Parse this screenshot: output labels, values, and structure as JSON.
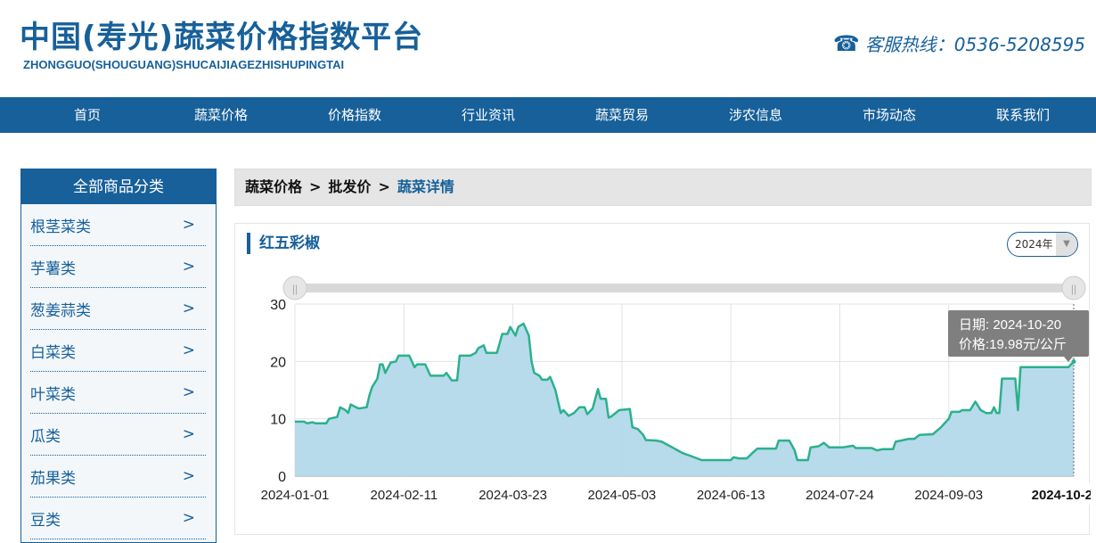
{
  "header": {
    "title": "中国(寿光)蔬菜价格指数平台",
    "subtitle": "ZHONGGUO(SHOUGUANG)SHUCAIJIAGEZHISHUPINGTAI",
    "hotline": "客服热线：0536-5208595"
  },
  "nav": [
    "首页",
    "蔬菜价格",
    "价格指数",
    "行业资讯",
    "蔬菜贸易",
    "涉农信息",
    "市场动态",
    "联系我们"
  ],
  "sidebar": {
    "title": "全部商品分类",
    "items": [
      "根茎菜类",
      "芋薯类",
      "葱姜蒜类",
      "白菜类",
      "叶菜类",
      "瓜类",
      "茄果类",
      "豆类"
    ],
    "arrow": ">"
  },
  "breadcrumb": {
    "items": [
      "蔬菜价格",
      "批发价"
    ],
    "current": "蔬菜详情",
    "sep": ">"
  },
  "panel": {
    "title": "红五彩椒",
    "year": "2024年"
  },
  "tooltip": {
    "date": "日期: 2024-10-20",
    "price": "价格:19.98元/公斤"
  },
  "chart_data": {
    "type": "area",
    "x_start": "2024-01-01",
    "x_unit": "days since 2024-01-01",
    "ylim": [
      0,
      30
    ],
    "yticks": [
      0,
      10,
      20,
      30
    ],
    "xticks": [
      {
        "day": 0,
        "label": "2024-01-01"
      },
      {
        "day": 41,
        "label": "2024-02-11"
      },
      {
        "day": 82,
        "label": "2024-03-23"
      },
      {
        "day": 123,
        "label": "2024-05-03"
      },
      {
        "day": 164,
        "label": "2024-06-13"
      },
      {
        "day": 205,
        "label": "2024-07-24"
      },
      {
        "day": 246,
        "label": "2024-09-03"
      }
    ],
    "highlight": {
      "day": 293,
      "label": "2024-10-20",
      "value": 19.98
    },
    "series": {
      "name": "价格",
      "color": "#2bb08d",
      "fill": "#b3d9ea",
      "points": [
        [
          0,
          9.5
        ],
        [
          3.5,
          9.5
        ],
        [
          4.6,
          9.2
        ],
        [
          6.6,
          9.4
        ],
        [
          7.7,
          9.2
        ],
        [
          11.8,
          9.2
        ],
        [
          12.8,
          10
        ],
        [
          15.9,
          10.3
        ],
        [
          17,
          12
        ],
        [
          19,
          11.5
        ],
        [
          20,
          11
        ],
        [
          21,
          12.5
        ],
        [
          23,
          12
        ],
        [
          24,
          11.8
        ],
        [
          27,
          12
        ],
        [
          28,
          14
        ],
        [
          29,
          15.5
        ],
        [
          31,
          17
        ],
        [
          32,
          19.5
        ],
        [
          33,
          19.5
        ],
        [
          34,
          18
        ],
        [
          36,
          19.8
        ],
        [
          38,
          20
        ],
        [
          39,
          21
        ],
        [
          43,
          21
        ],
        [
          45,
          19
        ],
        [
          46,
          19.5
        ],
        [
          49,
          19.5
        ],
        [
          51,
          17.5
        ],
        [
          56,
          17.5
        ],
        [
          57,
          18
        ],
        [
          59,
          16.7
        ],
        [
          61,
          16.7
        ],
        [
          62,
          21
        ],
        [
          66,
          21
        ],
        [
          68,
          21.5
        ],
        [
          69,
          22.3
        ],
        [
          71,
          22.8
        ],
        [
          72,
          21.5
        ],
        [
          76,
          21.5
        ],
        [
          78,
          24.8
        ],
        [
          80,
          24.8
        ],
        [
          81,
          26
        ],
        [
          83,
          24.5
        ],
        [
          84,
          26
        ],
        [
          86,
          26.6
        ],
        [
          88,
          24.5
        ],
        [
          89,
          20
        ],
        [
          90,
          18
        ],
        [
          92,
          17.5
        ],
        [
          93,
          16.8
        ],
        [
          95,
          16.8
        ],
        [
          96,
          17.3
        ],
        [
          98,
          15
        ],
        [
          100,
          11
        ],
        [
          101,
          11.5
        ],
        [
          103,
          10.5
        ],
        [
          105,
          11
        ],
        [
          107,
          12
        ],
        [
          109,
          12
        ],
        [
          110,
          10.8
        ],
        [
          112,
          11.8
        ],
        [
          114,
          15.2
        ],
        [
          115,
          13.5
        ],
        [
          117,
          13.5
        ],
        [
          118,
          10.2
        ],
        [
          119,
          10.4
        ],
        [
          122,
          11.5
        ],
        [
          126,
          11.7
        ],
        [
          127,
          8.5
        ],
        [
          129,
          8.2
        ],
        [
          131,
          7.2
        ],
        [
          132,
          6.3
        ],
        [
          136,
          6.2
        ],
        [
          138,
          6
        ],
        [
          140,
          5.5
        ],
        [
          142,
          5
        ],
        [
          144,
          4.5
        ],
        [
          146,
          4
        ],
        [
          149,
          3.5
        ],
        [
          153,
          2.8
        ],
        [
          164,
          2.8
        ],
        [
          165,
          3.3
        ],
        [
          167,
          3.1
        ],
        [
          170,
          3.1
        ],
        [
          172,
          4
        ],
        [
          174,
          4.8
        ],
        [
          181,
          4.8
        ],
        [
          182,
          6.2
        ],
        [
          186,
          6.2
        ],
        [
          188,
          4.5
        ],
        [
          189,
          2.8
        ],
        [
          193,
          2.8
        ],
        [
          194,
          5
        ],
        [
          197,
          5.2
        ],
        [
          199,
          5.8
        ],
        [
          201,
          5
        ],
        [
          206,
          5
        ],
        [
          210,
          5.3
        ],
        [
          211,
          4.9
        ],
        [
          217,
          4.9
        ],
        [
          219,
          4.5
        ],
        [
          221,
          4.7
        ],
        [
          225,
          4.7
        ],
        [
          226,
          6
        ],
        [
          228,
          6.2
        ],
        [
          231,
          6.5
        ],
        [
          233,
          6.5
        ],
        [
          235,
          7.2
        ],
        [
          240,
          7.3
        ],
        [
          243,
          8.5
        ],
        [
          245,
          9.5
        ],
        [
          246,
          10
        ],
        [
          247,
          11.2
        ],
        [
          250,
          11.2
        ],
        [
          251,
          11.5
        ],
        [
          254,
          11.5
        ],
        [
          256,
          13
        ],
        [
          258,
          11.5
        ],
        [
          260,
          11
        ],
        [
          262,
          11
        ],
        [
          263,
          12
        ],
        [
          264,
          11
        ],
        [
          265,
          11
        ],
        [
          266,
          17
        ],
        [
          271,
          17
        ],
        [
          272,
          11.5
        ],
        [
          273,
          19
        ],
        [
          291,
          19
        ],
        [
          293,
          19.98
        ]
      ]
    }
  }
}
